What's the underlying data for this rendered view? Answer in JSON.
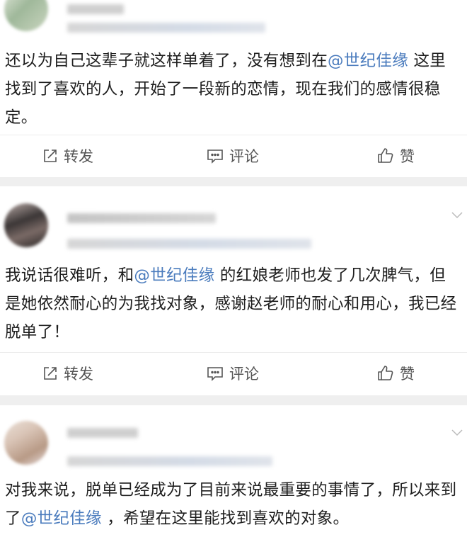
{
  "posts": [
    {
      "avatar_colors": [
        "#c9d5bf",
        "#9fb89a",
        "#e3e8dc"
      ],
      "text_before": "还以为自己这辈子就这样单着了，没有想到在",
      "mention": "@世纪佳缘",
      "text_after": " 这里找到了喜欢的人，开始了一段新的恋情，现在我们的感情很稳定。",
      "actions": {
        "repost": "转发",
        "comment": "评论",
        "like": "赞"
      }
    },
    {
      "avatar_colors": [
        "#3b3636",
        "#7a6a66",
        "#b9aaa6"
      ],
      "text_before": "我说话很难听，和",
      "mention": "@世纪佳缘",
      "text_after": " 的红娘老师也发了几次脾气，但是她依然耐心的为我找对象，感谢赵老师的耐心和用心，我已经脱单了！",
      "actions": {
        "repost": "转发",
        "comment": "评论",
        "like": "赞"
      }
    },
    {
      "avatar_colors": [
        "#d9c4b6",
        "#b89a86",
        "#eadfd6"
      ],
      "text_before": "对我来说，脱单已经成为了目前来说最重要的事情了，所以来到了",
      "mention": "@世纪佳缘",
      "text_after": " ，希望在这里能找到喜欢的对象。"
    }
  ],
  "colors": {
    "mention": "#4a7bbd",
    "separator": "#efefef",
    "action_text": "#555555",
    "blurred_name": "#c8c8c8",
    "blurred_meta": "#d4dbe6"
  },
  "icons": {
    "repost": "share-square-icon",
    "comment": "comment-bubble-icon",
    "like": "thumbs-up-icon",
    "chevron": "chevron-down-icon"
  }
}
